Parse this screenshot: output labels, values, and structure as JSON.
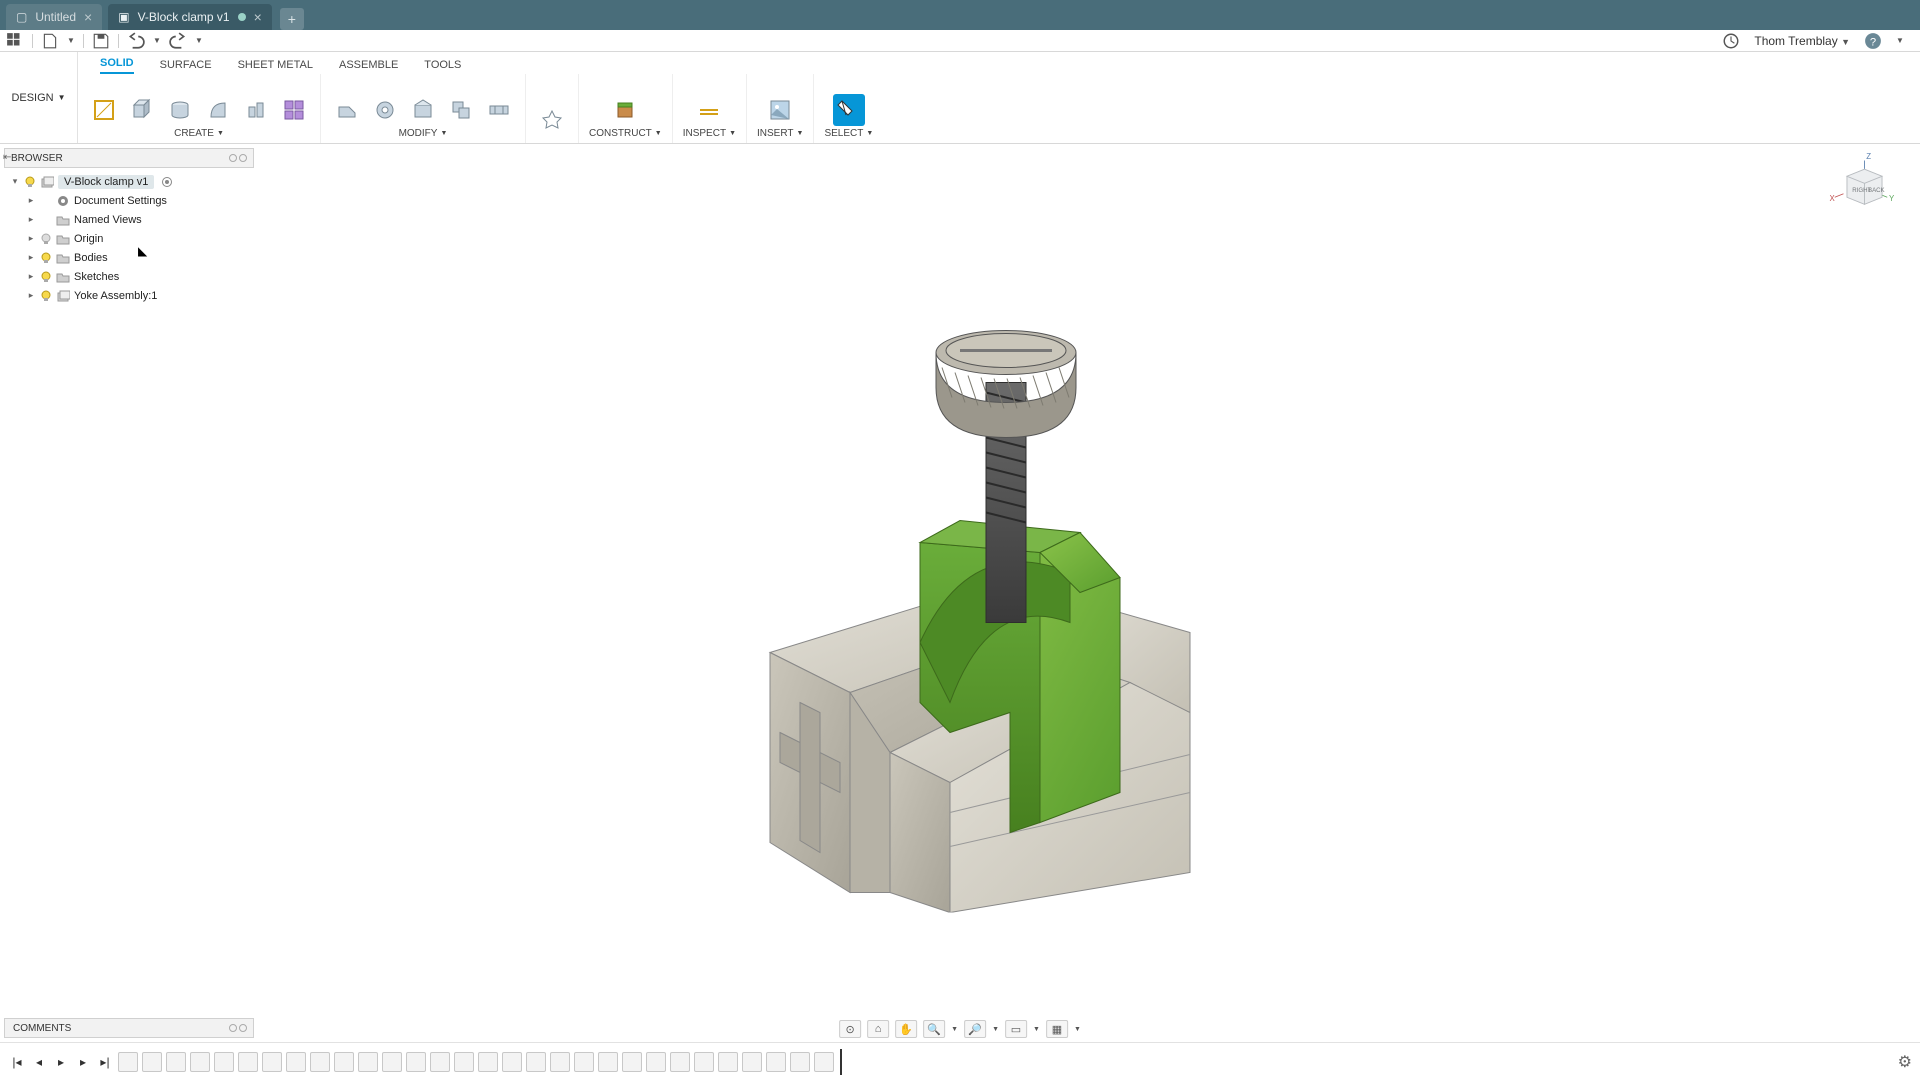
{
  "tabs": [
    {
      "title": "Untitled",
      "active": false,
      "dirty": false
    },
    {
      "title": "V-Block clamp v1",
      "active": true,
      "dirty": true
    }
  ],
  "user_name": "Thom Tremblay",
  "workspace": "DESIGN",
  "ribbon_tabs": [
    "SOLID",
    "SURFACE",
    "SHEET METAL",
    "ASSEMBLE",
    "TOOLS"
  ],
  "ribbon_active_tab": "SOLID",
  "ribbon_groups": [
    {
      "name": "CREATE",
      "has_caret": true,
      "tool_count": 6
    },
    {
      "name": "MODIFY",
      "has_caret": true,
      "tool_count": 5
    },
    {
      "name": "",
      "has_caret": false,
      "tool_count": 1
    },
    {
      "name": "CONSTRUCT",
      "has_caret": true,
      "tool_count": 1
    },
    {
      "name": "INSPECT",
      "has_caret": true,
      "tool_count": 1
    },
    {
      "name": "INSERT",
      "has_caret": true,
      "tool_count": 1
    },
    {
      "name": "SELECT",
      "has_caret": true,
      "tool_count": 1,
      "selected_idx": 0
    }
  ],
  "browser_title": "BROWSER",
  "browser_tree": {
    "root": "V-Block clamp v1",
    "children": [
      {
        "name": "Document Settings",
        "icon": "gear",
        "bulb": null
      },
      {
        "name": "Named Views",
        "icon": "folder",
        "bulb": null
      },
      {
        "name": "Origin",
        "icon": "folder",
        "bulb": "off"
      },
      {
        "name": "Bodies",
        "icon": "folder",
        "bulb": "on"
      },
      {
        "name": "Sketches",
        "icon": "folder",
        "bulb": "on"
      },
      {
        "name": "Yoke Assembly:1",
        "icon": "comp",
        "bulb": "on"
      }
    ]
  },
  "comments_title": "COMMENTS",
  "viewcube": {
    "axes": [
      "X",
      "Y",
      "Z"
    ],
    "faces": [
      "RIGHT",
      "BACK"
    ]
  },
  "navbar_tool_count": 7,
  "timeline_feature_count": 30
}
